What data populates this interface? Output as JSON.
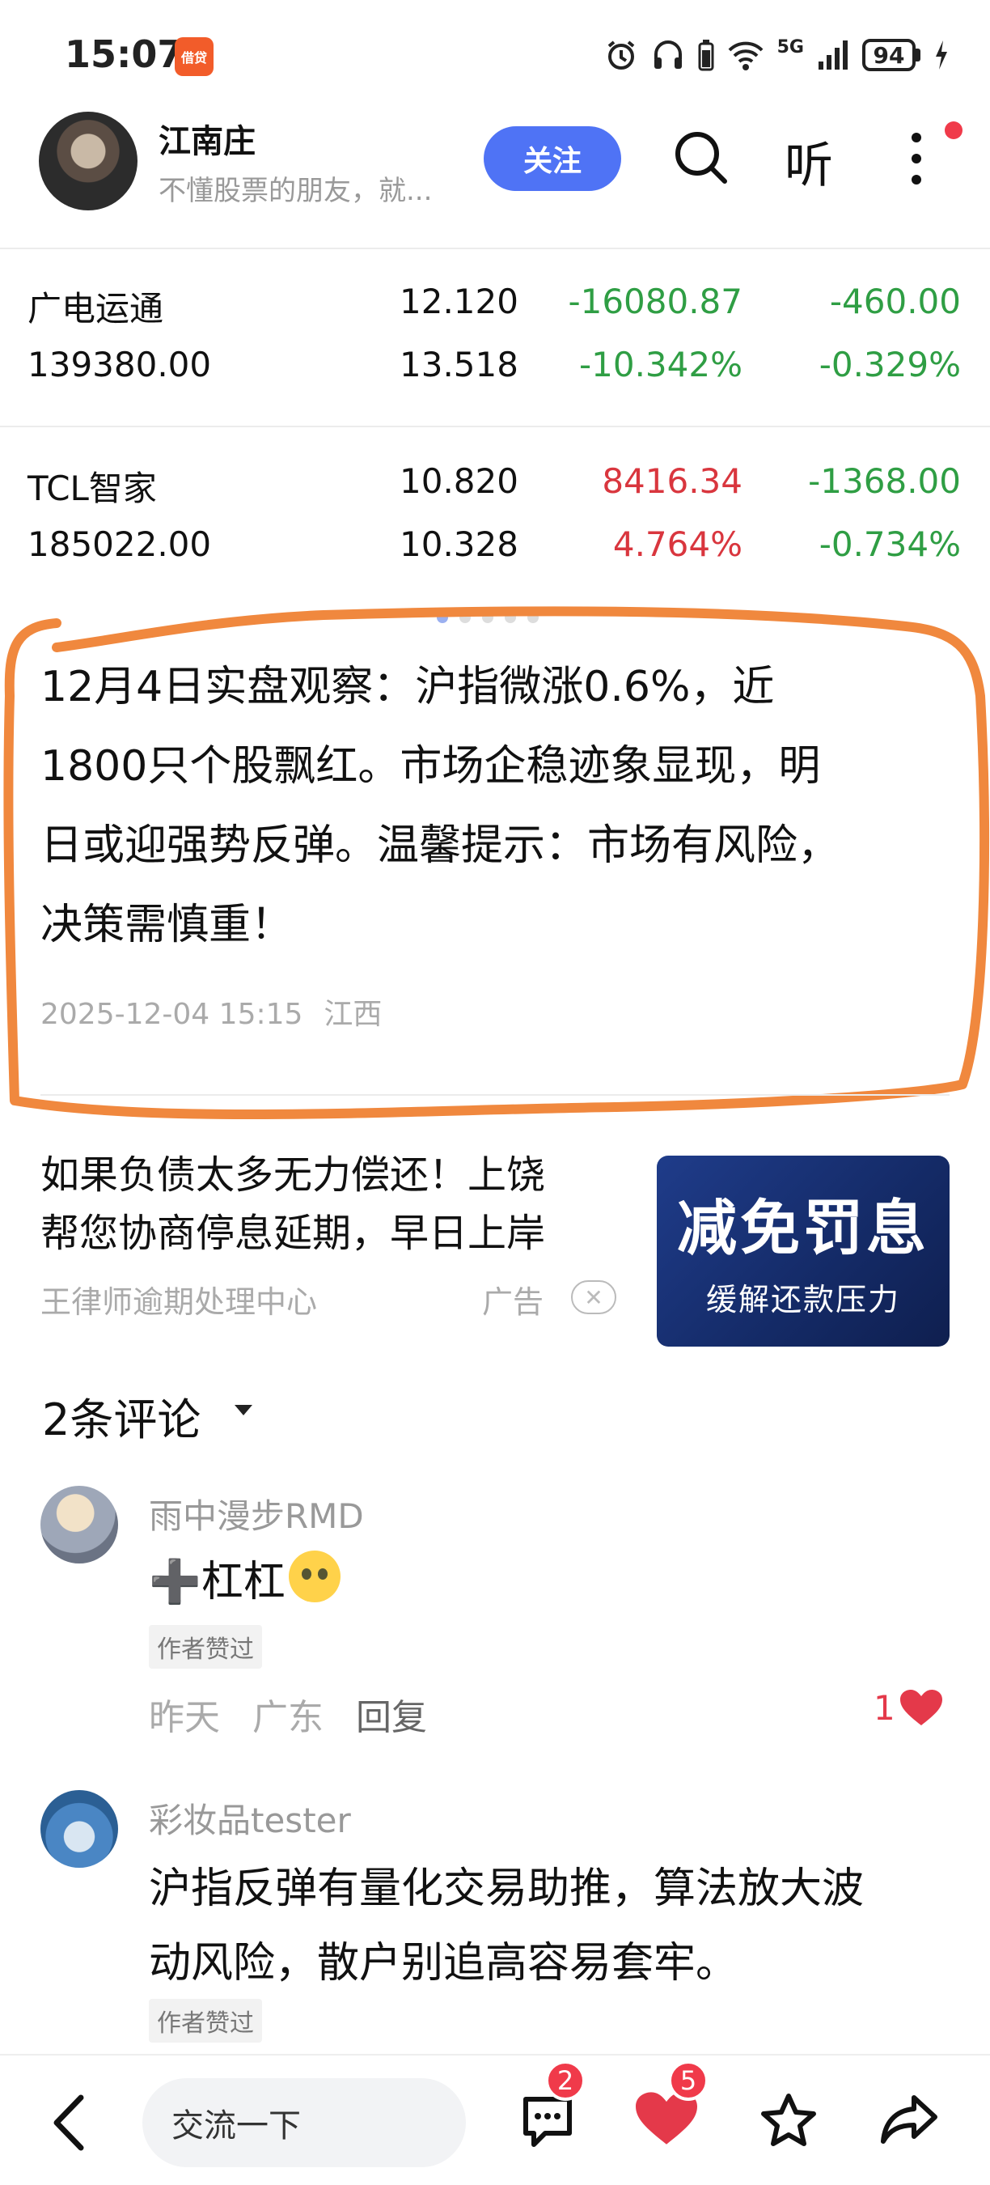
{
  "status_bar": {
    "time": "15:07",
    "app_badge": "借贷",
    "network": "5G",
    "battery": "94"
  },
  "header": {
    "author_name": "江南庄",
    "author_bio": "不懂股票的朋友，就...",
    "follow_label": "关注",
    "listen_label": "听"
  },
  "stocks": [
    {
      "name": "广电运通",
      "shares": "139380.00",
      "price": "12.120",
      "cost": "13.518",
      "pnl": "-16080.87",
      "pnl_pct": "-10.342%",
      "day_pnl": "-460.00",
      "day_pct": "-0.329%"
    },
    {
      "name": "TCL智家",
      "shares": "185022.00",
      "price": "10.820",
      "cost": "10.328",
      "pnl": "8416.34",
      "pnl_pct": "4.764%",
      "day_pnl": "-1368.00",
      "day_pct": "-0.734%"
    }
  ],
  "post": {
    "lines": [
      "12月4日实盘观察：沪指微涨0.6%，近",
      "1800只个股飘红。市场企稳迹象显现，明",
      "日或迎强势反弹。温馨提示：市场有风险，",
      "决策需慎重！"
    ],
    "datetime": "2025-12-04 15:15",
    "location": "江西"
  },
  "ad": {
    "line1": "如果负债太多无力偿还！上饶",
    "line2": "帮您协商停息延期，早日上岸",
    "source": "王律师逾期处理中心",
    "label": "广告",
    "image_title": "减免罚息",
    "image_subtitle": "缓解还款压力"
  },
  "comments": {
    "title": "2条评论",
    "items": [
      {
        "user": "雨中漫步RMD",
        "text": "➕杠杠",
        "badge": "作者赞过",
        "time": "昨天",
        "location": "广东",
        "reply": "回复",
        "likes": "1"
      },
      {
        "user": "彩妆品tester",
        "line1": "沪指反弹有量化交易助推，算法放大波",
        "line2": "动风险，散户别追高容易套牢。",
        "badge": "作者赞过"
      }
    ]
  },
  "bottom_bar": {
    "input_placeholder": "交流一下",
    "comment_count": "2",
    "like_count": "5"
  },
  "colors": {
    "follow_button": "#4f73f5",
    "loss_green": "#2f9e44",
    "gain_red": "#d9363e",
    "annotation_orange": "#f0883e",
    "like_red": "#e4394a"
  }
}
